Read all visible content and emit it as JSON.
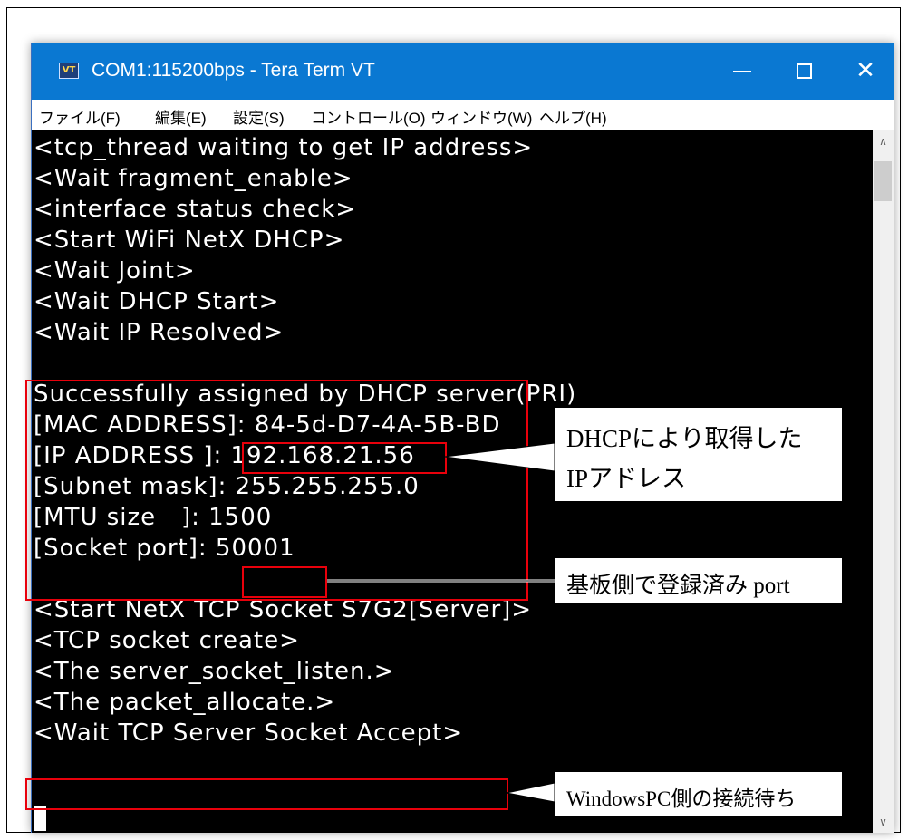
{
  "window": {
    "title": "COM1:115200bps - Tera Term VT",
    "icon_label": "VT"
  },
  "menu": [
    "ファイル(F)",
    "編集(E)",
    "設定(S)",
    "コントロール(O)",
    "ウィンドウ(W)",
    "ヘルプ(H)"
  ],
  "terminal": {
    "lines": [
      "<tcp_thread waiting to get IP address>",
      "<Wait fragment_enable>",
      "<interface status check>",
      "<Start WiFi NetX DHCP>",
      "<Wait Joint>",
      "<Wait DHCP Start>",
      "<Wait IP Resolved>",
      "",
      "Successfully assigned by DHCP server(PRI)",
      "[MAC ADDRESS]: 84-5d-D7-4A-5B-BD",
      "[IP ADDRESS ]: 192.168.21.56",
      "[Subnet mask]: 255.255.255.0",
      "[MTU size   ]: 1500",
      "[Socket port]: 50001",
      "",
      "<Start NetX TCP Socket S7G2[Server]>",
      "<TCP socket create>",
      "<The server_socket_listen.>",
      "<The packet_allocate.>",
      "<Wait TCP Server Socket Accept>"
    ]
  },
  "annotations": {
    "dhcp_ip": [
      "DHCPにより取得した",
      "IPアドレス"
    ],
    "port": "基板側で登録済み port",
    "wait": "WindowsPC側の接続待ち"
  }
}
